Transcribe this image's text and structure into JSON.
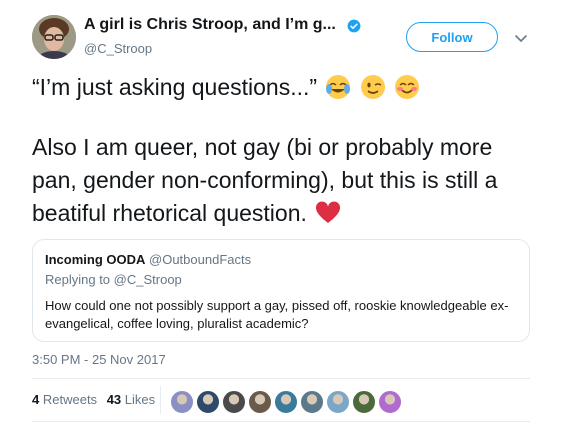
{
  "header": {
    "display_name": "A girl is Chris Stroop, and I’m g...",
    "handle": "@C_Stroop",
    "follow_label": "Follow"
  },
  "tweet": {
    "line1": "“I’m just asking questions...”",
    "line2": "Also I am queer, not gay (bi or probably more pan, gender non-conforming), but this is still a beatiful rhetorical question.",
    "emojis": [
      "joy-emoji",
      "wink-emoji",
      "blush-emoji",
      "red-heart-emoji"
    ]
  },
  "quote": {
    "name": "Incoming OODA",
    "handle": "@OutboundFacts",
    "replying_prefix": "Replying to",
    "replying_handle": "@C_Stroop",
    "text": "How could one not possibly support a gay, pissed off, rooskie knowledgeable  ex-evangelical, coffee loving, pluralist academic?"
  },
  "timestamp": "3:50 PM - 25 Nov 2017",
  "stats": {
    "retweets_count": "4",
    "retweets_label": "Retweets",
    "likes_count": "43",
    "likes_label": "Likes"
  },
  "colors": {
    "accent": "#1da1f2",
    "secondary_text": "#657786",
    "heart": "#e0245e"
  },
  "likers": [
    "avatar-1",
    "avatar-2",
    "avatar-3",
    "avatar-4",
    "avatar-5",
    "avatar-6",
    "avatar-7",
    "avatar-8",
    "avatar-9"
  ]
}
